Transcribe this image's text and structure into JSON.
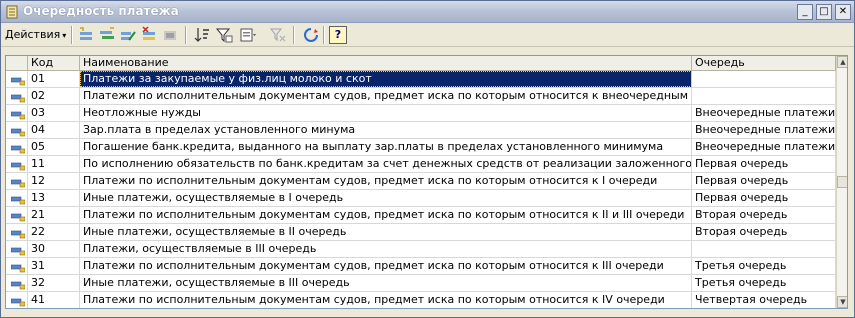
{
  "window": {
    "title": "Очередность платежа",
    "controls": {
      "minimize": "_",
      "maximize": "□",
      "close": "✕"
    }
  },
  "toolbar": {
    "actions_label": "Действия",
    "actions_arrow": "▾",
    "icons": [
      "add-row-icon",
      "copy-row-icon",
      "edit-row-icon",
      "mark-delete-icon",
      "delete-icon",
      "sort-icon",
      "filter-list-icon",
      "filter-icon",
      "clear-filter-icon",
      "refresh-icon",
      "help-icon"
    ],
    "help_label": "?"
  },
  "table": {
    "columns": {
      "code": "Код",
      "name": "Наименование",
      "queue": "Очередь"
    },
    "rows": [
      {
        "code": "01",
        "name": "Платежи за закупаемые у физ.лиц молоко и скот",
        "queue": ""
      },
      {
        "code": "02",
        "name": "Платежи по исполнительным документам судов, предмет иска по которым относится к внеочередным платежам",
        "queue": ""
      },
      {
        "code": "03",
        "name": "Неотложные нужды",
        "queue": "Внеочередные платежи"
      },
      {
        "code": "04",
        "name": "Зар.плата в пределах установленного минума",
        "queue": "Внеочередные платежи"
      },
      {
        "code": "05",
        "name": "Погашение банк.кредита, выданного на выплату зар.платы в пределах установленного минимума",
        "queue": "Внеочередные платежи"
      },
      {
        "code": "11",
        "name": "По исполнению обязательств по банк.кредитам за счет денежных средств от реализации заложенного имущества",
        "queue": "Первая очередь"
      },
      {
        "code": "12",
        "name": "Платежи по исполнительным документам судов, предмет иска по которым относится к I очереди",
        "queue": "Первая очередь"
      },
      {
        "code": "13",
        "name": "Иные платежи, осуществляемые в I очередь",
        "queue": "Первая очередь"
      },
      {
        "code": "21",
        "name": "Платежи по исполнительным документам судов, предмет иска по которым относится к II и III очереди",
        "queue": "Вторая очередь"
      },
      {
        "code": "22",
        "name": "Иные платежи, осуществляемые в II очередь",
        "queue": "Вторая очередь"
      },
      {
        "code": "30",
        "name": "Платежи, осуществляемые в III очередь",
        "queue": ""
      },
      {
        "code": "31",
        "name": "Платежи по исполнительным документам судов, предмет иска по которым относится к III очереди",
        "queue": "Третья очередь"
      },
      {
        "code": "32",
        "name": "Иные платежи, осуществляемые в III очередь",
        "queue": "Третья очередь"
      },
      {
        "code": "41",
        "name": "Платежи по исполнительным документам судов, предмет иска по которым относится к IV очереди",
        "queue": "Четвертая очередь"
      }
    ],
    "selected_row": 0
  },
  "scrollbar": {
    "up": "▲",
    "down": "▼"
  }
}
